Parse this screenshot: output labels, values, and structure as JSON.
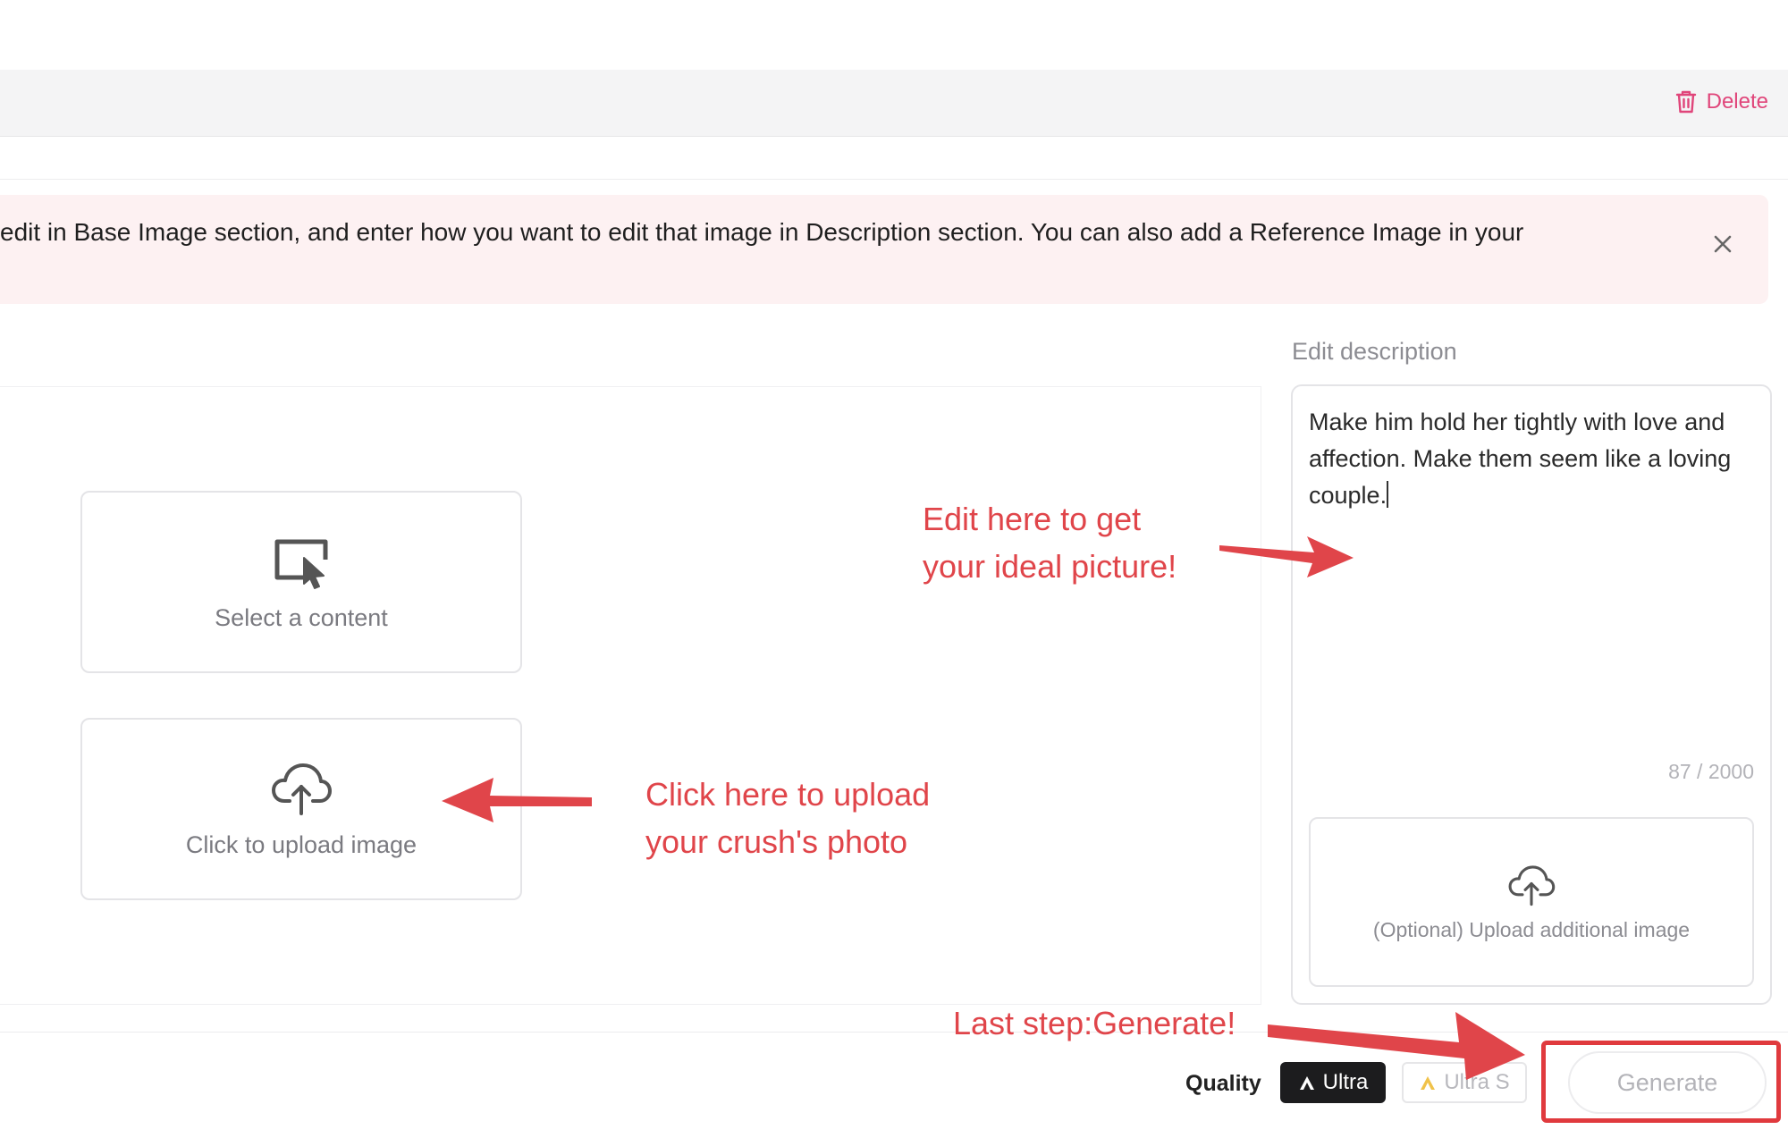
{
  "toolbar": {
    "delete_label": "Delete"
  },
  "banner": {
    "text": "edit in Base Image section, and enter how you want to edit that image in Description section. You can also add a Reference Image in your"
  },
  "base_image": {
    "select_content_label": "Select a content",
    "upload_label": "Click to upload image"
  },
  "description": {
    "label": "Edit description",
    "text": "Make him hold her tightly with love and affection. Make them seem like a loving couple.",
    "char_count": "87 / 2000",
    "optional_upload_label": "(Optional) Upload additional image"
  },
  "bottom_bar": {
    "quality_label": "Quality",
    "quality_options": [
      "Ultra",
      "Ultra S"
    ],
    "generate_label": "Generate"
  },
  "annotations": {
    "edit_line1": "Edit here to get",
    "edit_line2": "your ideal picture!",
    "upload_line1": "Click here to upload",
    "upload_line2": "your crush's photo",
    "generate": "Last step:Generate!"
  },
  "colors": {
    "accent_red": "#e0454a",
    "delete_pink": "#e0457a",
    "banner_bg": "#fdf1f2"
  }
}
